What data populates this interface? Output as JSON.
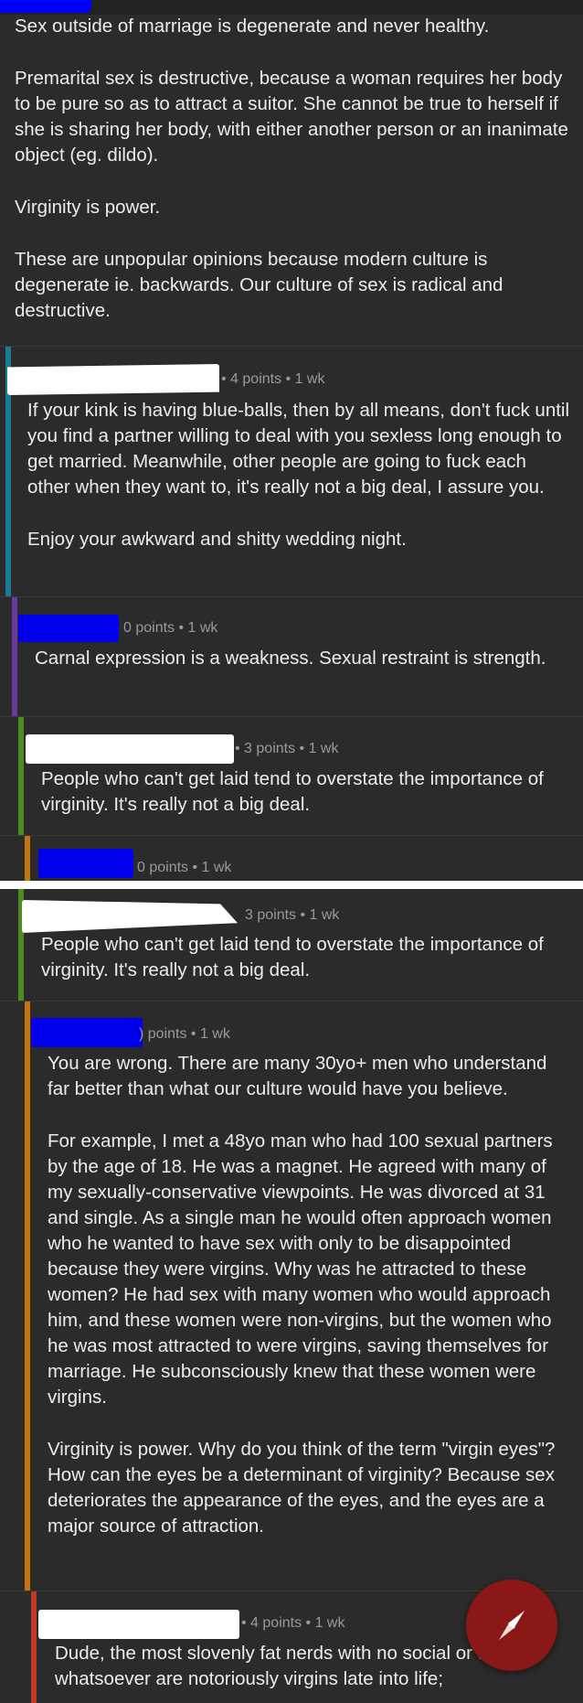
{
  "post": {
    "paragraphs": [
      "Sex outside of marriage is degenerate and never healthy.",
      "Premarital sex is destructive, because a woman requires her body to be pure so as to attract a suitor. She cannot be true to herself if she is sharing her body, with either another person or an inanimate object (eg. dildo).",
      "Virginity is power.",
      "These are unpopular opinions because modern culture is degenerate ie. backwards. Our culture of sex is radical and destructive."
    ]
  },
  "screenshot1": {
    "c1": {
      "meta": "• 4 points • 1 wk",
      "paragraphs": [
        "If your kink is having blue-balls, then by all means, don't fuck until you find a partner willing to deal with you sexless long enough to get married. Meanwhile, other people are going to fuck each other when they want to, it's really not a big deal, I assure you.",
        "Enjoy your awkward and shitty wedding night."
      ]
    },
    "c2": {
      "meta": "0 points • 1 wk",
      "paragraphs": [
        "Carnal expression is a weakness. Sexual restraint is strength."
      ]
    },
    "c3": {
      "meta": "• 3 points • 1 wk",
      "paragraphs": [
        "People who can't get laid tend to overstate the importance of virginity. It's really not a big deal."
      ]
    },
    "c4": {
      "meta": "0 points • 1 wk"
    }
  },
  "screenshot2": {
    "c1": {
      "meta": "3 points • 1 wk",
      "paragraphs": [
        "People who can't get laid tend to overstate the importance of virginity. It's really not a big deal."
      ]
    },
    "c2": {
      "meta": ") points • 1 wk",
      "paragraphs": [
        "You are wrong. There are many 30yo+ men who understand far better than what our culture would have you believe.",
        "For example, I met a 48yo man who had 100 sexual partners by the age of 18. He was a magnet. He agreed with many of my sexually-conservative viewpoints. He was divorced at 31 and single. As a single man he would often approach women who he wanted to have sex with only to be disappointed because they were virgins. Why was he attracted to these women? He had sex with many women who would approach him, and these women were non-virgins, but the women who he was most attracted to were virgins, saving themselves for marriage. He subconsciously knew that these women were virgins.",
        "Virginity is power. Why do you think of the term \"virgin eyes\"? How can the eyes be a determinant of virginity? Because sex deteriorates the appearance of the eyes, and the eyes are a major source of attraction."
      ]
    },
    "c3": {
      "meta": "• 4 points • 1 wk",
      "paragraphs": [
        "Dude, the most slovenly fat nerds with no social or talents whatsoever are notoriously virgins late into life;"
      ]
    }
  },
  "colors": {
    "rail_teal": "#1b7c96",
    "rail_purple": "#6a3a9e",
    "rail_green": "#4f8a22",
    "rail_orange": "#c7730e",
    "rail_red": "#c0392b",
    "redaction_blue": "#0000ee",
    "fab": "#8b1717"
  },
  "icons": {
    "fab": "compass-icon"
  }
}
